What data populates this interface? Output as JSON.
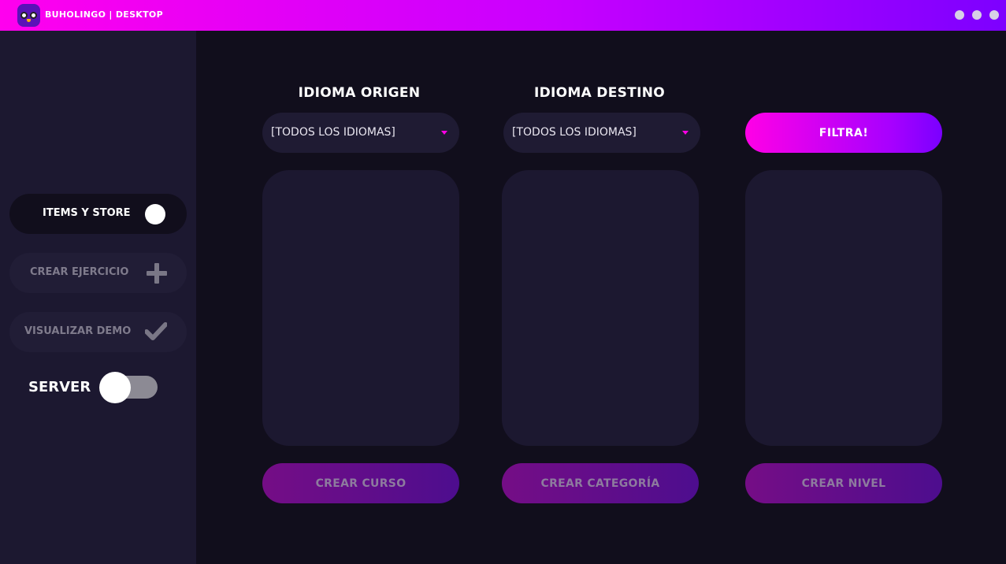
{
  "app": {
    "title": "BUHOLINGO | DESKTOP"
  },
  "sidebar": {
    "items": [
      {
        "label": "ITEMS Y STORE",
        "icon": "toggle-knob-icon",
        "active": true
      },
      {
        "label": "CREAR EJERCICIO",
        "icon": "plus-icon",
        "active": false
      },
      {
        "label": "VISUALIZAR DEMO",
        "icon": "check-icon",
        "active": false
      }
    ],
    "server": {
      "label": "SERVER",
      "enabled": false
    }
  },
  "filters": {
    "origin": {
      "label": "IDIOMA ORIGEN",
      "value": "[TODOS LOS IDIOMAS]"
    },
    "destination": {
      "label": "IDIOMA DESTINO",
      "value": "[TODOS LOS IDIOMAS]"
    },
    "apply_label": "FILTRA!"
  },
  "actions": {
    "create_course": "CREAR CURSO",
    "create_category": "CREAR CATEGORÍA",
    "create_level": "CREAR NIVEL"
  },
  "colors": {
    "accent_start": "#ff00e6",
    "accent_end": "#7a00ff",
    "background": "#110e1c",
    "panel": "#1c1830"
  }
}
